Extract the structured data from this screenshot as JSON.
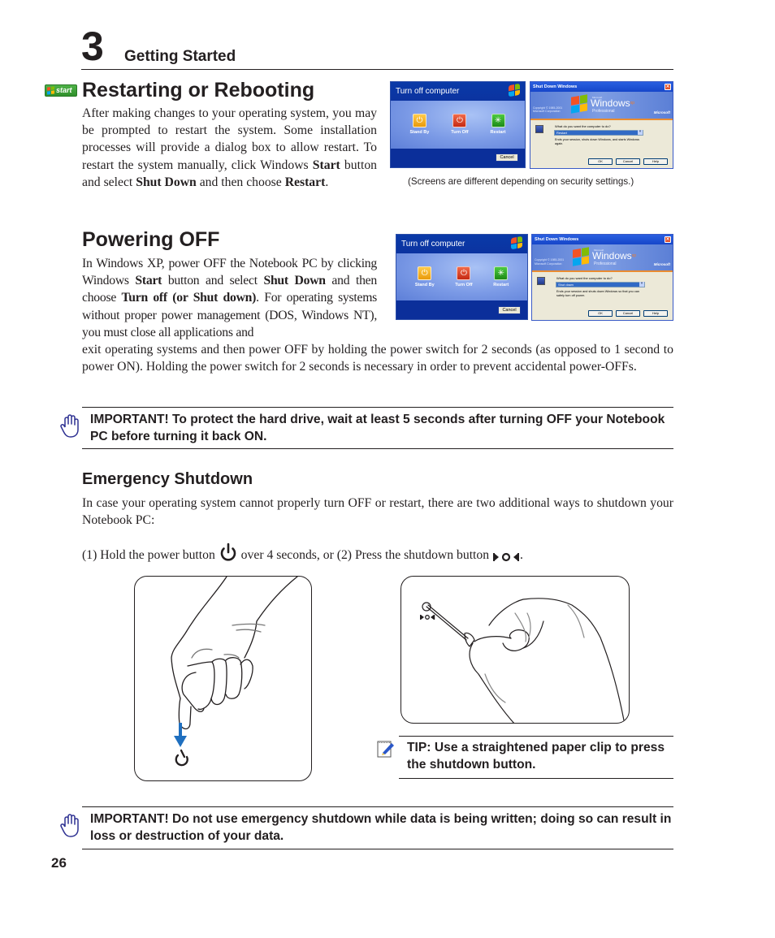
{
  "header": {
    "chapter_number": "3",
    "chapter_title": "Getting Started"
  },
  "restart_section": {
    "badge_label": "start",
    "title": "Restarting or Rebooting",
    "paragraph": {
      "p1": "After making changes to your operating system, you may be prompted to restart the system. Some installation processes will provide a dialog box to allow restart. To restart the system manually, click Windows ",
      "b1": "Start",
      "p2": " button and select ",
      "b2": "Shut Down",
      "p3": " and then choose ",
      "b3": "Restart",
      "p4": "."
    },
    "caption": "(Screens are different depending on security settings.)",
    "turn_off_dialog": {
      "title": "Turn off computer",
      "options": [
        "Stand By",
        "Turn Off",
        "Restart"
      ],
      "cancel": "Cancel"
    },
    "shutdown_dialog": {
      "title": "Shut Down Windows",
      "copyright": "Copyright © 1985-2001\nMicrosoft Corporation",
      "brand_small": "Microsoft",
      "brand": "Windows",
      "brand_sup": "xp",
      "edition": "Professional",
      "vendor": "Microsoft",
      "question": "What do you want the computer to do?",
      "selected": "Restart",
      "description": "Ends your session, shuts down Windows, and starts Windows again.",
      "buttons": [
        "OK",
        "Cancel",
        "Help"
      ]
    }
  },
  "power_section": {
    "title": "Powering OFF",
    "paragraph": {
      "p1": "In Windows XP, power OFF the Notebook PC by clicking Windows ",
      "b1": "Start",
      "p2": " button and select ",
      "b2": "Shut Down",
      "p3": " and then choose ",
      "b3": "Turn off (or Shut down)",
      "p4": ". For operating systems without proper power management (DOS, Windows NT), you must close all applications and"
    },
    "paragraph_cont": "exit operating systems and then power OFF by holding the power switch for 2 seconds (as opposed to 1 second to power ON). Holding the power switch for 2 seconds is necessary in order to prevent accidental power-OFFs.",
    "turn_off_dialog": {
      "title": "Turn off computer",
      "options": [
        "Stand By",
        "Turn Off",
        "Restart"
      ],
      "cancel": "Cancel"
    },
    "shutdown_dialog": {
      "title": "Shut Down Windows",
      "copyright": "Copyright © 1985-2001\nMicrosoft Corporation",
      "brand_small": "Microsoft",
      "brand": "Windows",
      "brand_sup": "xp",
      "edition": "Professional",
      "vendor": "Microsoft",
      "question": "What do you want the computer to do?",
      "selected": "Shut down",
      "description": "Ends your session and shuts down Windows so that you can safely turn off power.",
      "buttons": [
        "OK",
        "Cancel",
        "Help"
      ]
    },
    "important": "IMPORTANT!  To protect the hard drive, wait at least 5 seconds after turning OFF your Notebook PC before turning it back ON."
  },
  "emergency_section": {
    "title": "Emergency Shutdown",
    "paragraph": "In case your operating system cannot properly turn OFF or restart, there are two additional ways to shutdown your Notebook PC:",
    "steps": {
      "s1": "(1) Hold the power button ",
      "s2": " over 4 seconds, or  (2) Press the shutdown button ",
      "s3": "."
    },
    "tip": "TIP: Use a straightened paper clip to press the shutdown button.",
    "important": "IMPORTANT!  Do not use emergency shutdown while data is being written; doing so can result in loss or destruction of your data."
  },
  "footer": {
    "page_number": "26"
  },
  "colors": {
    "text": "#231f20",
    "icon_blue": "#2e3192",
    "arrow_blue": "#1f6fbf",
    "xp_blue": "#0b33a0"
  }
}
